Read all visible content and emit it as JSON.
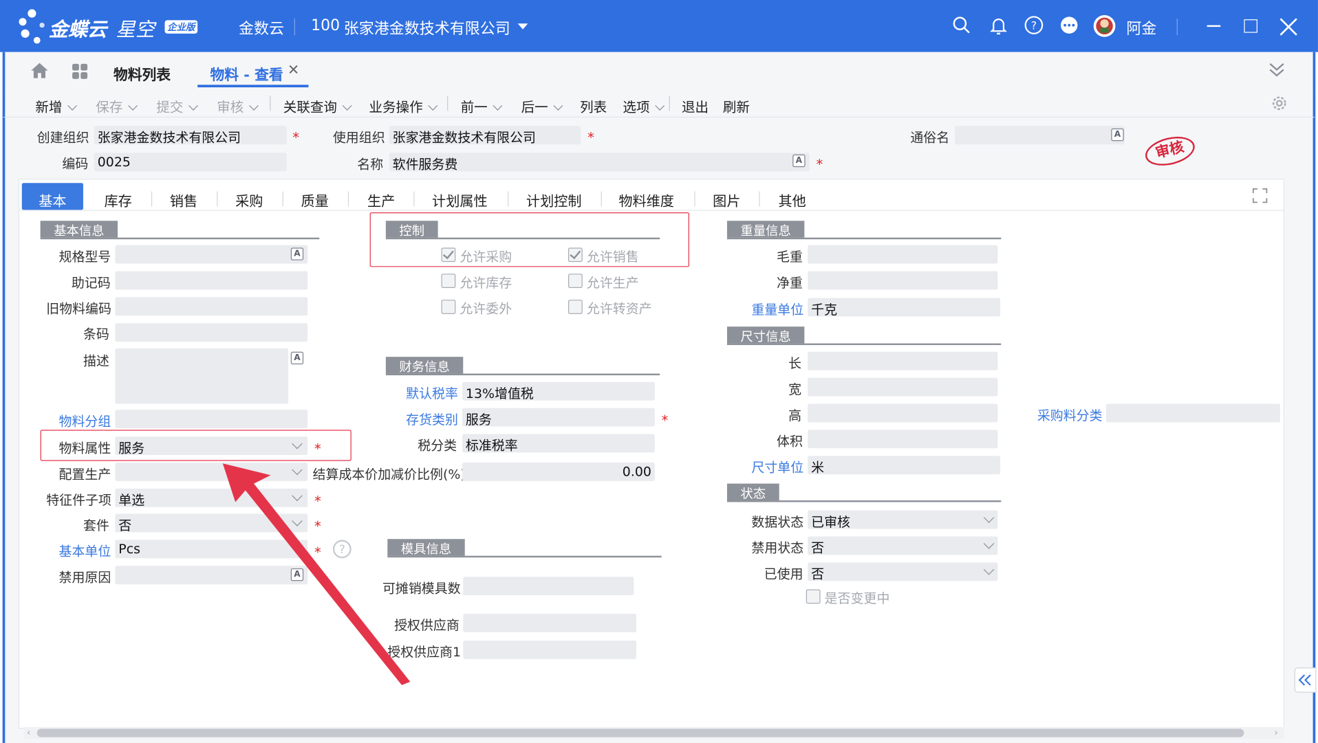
{
  "app": {
    "brand": "金蝶云",
    "product": "星空",
    "edition": "企业版",
    "cloud": "金数云",
    "org_code": "100",
    "org_name": "张家港金数技术有限公司",
    "user": "阿金"
  },
  "tabs": {
    "list": "物料列表",
    "active": "物料 - 查看"
  },
  "toolbar": {
    "new": "新增",
    "save": "保存",
    "submit": "提交",
    "audit": "审核",
    "related": "关联查询",
    "business": "业务操作",
    "prev": "前一",
    "next": "后一",
    "list": "列表",
    "options": "选项",
    "exit": "退出",
    "refresh": "刷新"
  },
  "header": {
    "create_org_label": "创建组织",
    "create_org": "张家港金数技术有限公司",
    "use_org_label": "使用组织",
    "use_org": "张家港金数技术有限公司",
    "common_name_label": "通俗名",
    "code_label": "编码",
    "code": "0025",
    "name_label": "名称",
    "name": "软件服务费",
    "stamp": "审核"
  },
  "page_tabs": [
    "基本",
    "库存",
    "销售",
    "采购",
    "质量",
    "生产",
    "计划属性",
    "计划控制",
    "物料维度",
    "图片",
    "其他"
  ],
  "basic": {
    "section": "基本信息",
    "spec": "规格型号",
    "mnemonic": "助记码",
    "old_code": "旧物料编码",
    "barcode": "条码",
    "desc": "描述",
    "group": "物料分组",
    "attr_label": "物料属性",
    "attr": "服务",
    "config_label": "配置生产",
    "feature_label": "特征件子项",
    "feature": "单选",
    "kit_label": "套件",
    "kit": "否",
    "unit_label": "基本单位",
    "unit": "Pcs",
    "disable_reason": "禁用原因"
  },
  "control": {
    "section": "控制",
    "allow_purchase": "允许采购",
    "allow_sale": "允许销售",
    "allow_stock": "允许库存",
    "allow_produce": "允许生产",
    "allow_outsource": "允许委外",
    "allow_asset": "允许转资产"
  },
  "finance": {
    "section": "财务信息",
    "tax_rate_label": "默认税率",
    "tax_rate": "13%增值税",
    "stock_cat_label": "存货类别",
    "stock_cat": "服务",
    "tax_class_label": "税分类",
    "tax_class": "标准税率",
    "settle_ratio_label": "结算成本价加减价比例(%)",
    "settle_ratio": "0.00"
  },
  "mold": {
    "section": "模具信息",
    "count": "可摊销模具数",
    "supplier": "授权供应商",
    "supplier1": "授权供应商1"
  },
  "weight": {
    "section": "重量信息",
    "gross": "毛重",
    "net": "净重",
    "unit_label": "重量单位",
    "unit": "千克"
  },
  "size": {
    "section": "尺寸信息",
    "length": "长",
    "width": "宽",
    "height": "高",
    "volume": "体积",
    "unit_label": "尺寸单位",
    "unit": "米",
    "purchase_cat": "采购料分类"
  },
  "status": {
    "section": "状态",
    "data_label": "数据状态",
    "data": "已审核",
    "forbid_label": "禁用状态",
    "forbid": "否",
    "used_label": "已使用",
    "used": "否",
    "changing": "是否变更中"
  }
}
